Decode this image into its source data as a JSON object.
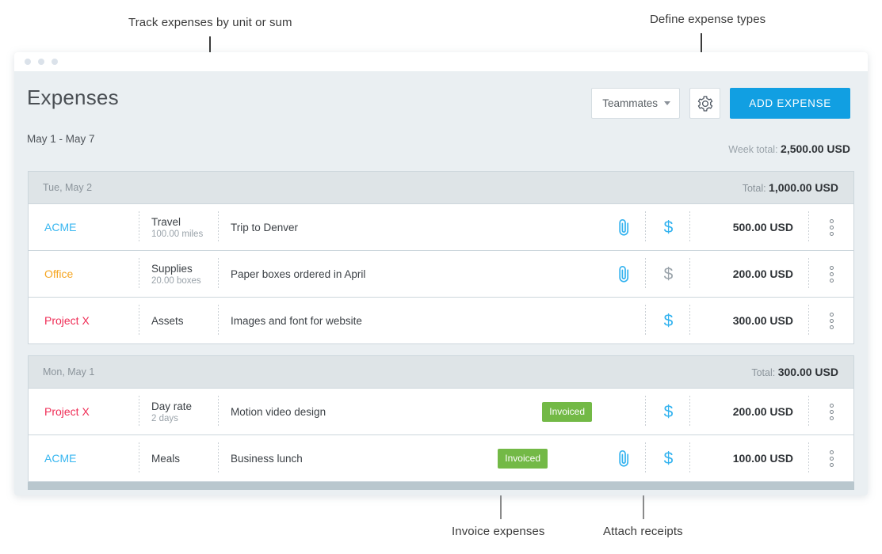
{
  "annotations": [
    {
      "id": "a1",
      "text": "Track expenses by unit or sum"
    },
    {
      "id": "a2",
      "text": "Define expense types"
    },
    {
      "id": "a3",
      "text": "Invoice expenses"
    },
    {
      "id": "a4",
      "text": "Attach receipts"
    }
  ],
  "window": {
    "traffic_lights": [
      "dot",
      "dot",
      "dot"
    ]
  },
  "header": {
    "title": "Expenses",
    "date_range": "May 1 - May 7",
    "teammates_label": "Teammates",
    "settings_icon": "gear-icon",
    "add_expense_label": "ADD EXPENSE",
    "week_total_label": "Week total:",
    "week_total_value": "2,500.00 USD"
  },
  "colors": {
    "accent_blue": "#119fe2",
    "badge_green": "#73b946",
    "client_acme": "#37b6f0",
    "client_office": "#f5a623",
    "client_project_x": "#ef2d56",
    "dollar_active": "#32b2ef",
    "dollar_inactive": "#9aa3aa"
  },
  "groups": [
    {
      "day": "Tue, May 2",
      "total_label": "Total:",
      "total_value": "1,000.00 USD",
      "rows": [
        {
          "client": "ACME",
          "client_color": "#37b6f0",
          "type": "Travel",
          "units": "100.00 miles",
          "description": "Trip to Denver",
          "badge": null,
          "attachment": true,
          "dollar_active": true,
          "amount": "500.00 USD"
        },
        {
          "client": "Office",
          "client_color": "#f5a623",
          "type": "Supplies",
          "units": "20.00 boxes",
          "description": "Paper boxes ordered in April",
          "badge": null,
          "attachment": true,
          "dollar_active": false,
          "amount": "200.00 USD"
        },
        {
          "client": "Project X",
          "client_color": "#ef2d56",
          "type": "Assets",
          "units": "",
          "description": "Images and font for website",
          "badge": null,
          "attachment": false,
          "dollar_active": true,
          "amount": "300.00 USD"
        }
      ]
    },
    {
      "day": "Mon, May 1",
      "total_label": "Total:",
      "total_value": "300.00 USD",
      "rows": [
        {
          "client": "Project X",
          "client_color": "#ef2d56",
          "type": "Day rate",
          "units": "2 days",
          "description": "Motion video design",
          "badge": "Invoiced",
          "attachment": false,
          "dollar_active": true,
          "amount": "200.00 USD"
        },
        {
          "client": "ACME",
          "client_color": "#37b6f0",
          "type": "Meals",
          "units": "",
          "description": "Business lunch",
          "badge": "Invoiced",
          "badge_shift": true,
          "attachment": true,
          "dollar_active": true,
          "amount": "100.00 USD"
        }
      ]
    }
  ]
}
